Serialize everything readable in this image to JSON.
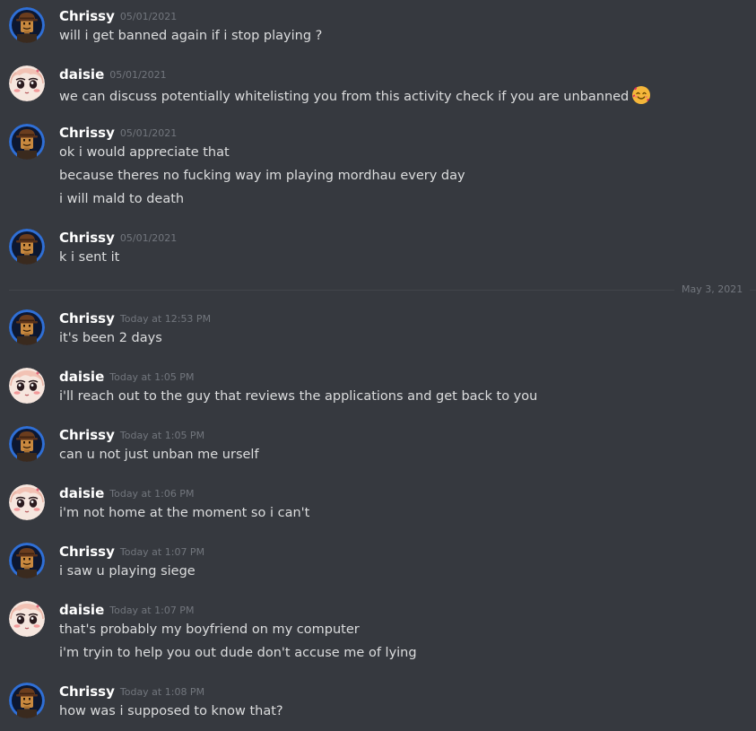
{
  "users": {
    "chrissy": {
      "name": "Chrissy",
      "avatar_icon": "lego-minifigure-avatar"
    },
    "daisie": {
      "name": "daisie",
      "avatar_icon": "anime-girl-avatar"
    }
  },
  "date_divider": "May 3, 2021",
  "groups": [
    {
      "author": "Chrissy",
      "timestamp": "05/01/2021",
      "lines": [
        "will i get banned again if i stop playing ?"
      ]
    },
    {
      "author": "daisie",
      "timestamp": "05/01/2021",
      "lines": [
        "we can discuss potentially whitelisting you from this activity check if you are unbanned"
      ],
      "emoji": "smiling-face-with-hearts"
    },
    {
      "author": "Chrissy",
      "timestamp": "05/01/2021",
      "lines": [
        "ok i would appreciate that",
        "because theres no fucking way im playing mordhau every day",
        "i will mald to death"
      ]
    },
    {
      "author": "Chrissy",
      "timestamp": "05/01/2021",
      "lines": [
        "k i sent it"
      ]
    },
    {
      "author": "Chrissy",
      "timestamp": "Today at 12:53 PM",
      "lines": [
        "it's been 2 days"
      ]
    },
    {
      "author": "daisie",
      "timestamp": "Today at 1:05 PM",
      "lines": [
        "i'll reach out to the guy that reviews the applications and get back to you"
      ]
    },
    {
      "author": "Chrissy",
      "timestamp": "Today at 1:05 PM",
      "lines": [
        "can u not just unban me urself"
      ]
    },
    {
      "author": "daisie",
      "timestamp": "Today at 1:06 PM",
      "lines": [
        "i'm not home at the moment so i can't"
      ]
    },
    {
      "author": "Chrissy",
      "timestamp": "Today at 1:07 PM",
      "lines": [
        "i saw u playing siege"
      ]
    },
    {
      "author": "daisie",
      "timestamp": "Today at 1:07 PM",
      "lines": [
        "that's probably my boyfriend on my computer",
        "i'm tryin to help you out dude don't accuse me of lying"
      ]
    },
    {
      "author": "Chrissy",
      "timestamp": "Today at 1:08 PM",
      "lines": [
        "how was i supposed to know that?"
      ]
    }
  ],
  "colors": {
    "background": "#36393f",
    "username": "#ffffff",
    "message_text": "#dcddde",
    "timestamp": "#72767d",
    "avatar_ring": "#2f6fd6"
  }
}
